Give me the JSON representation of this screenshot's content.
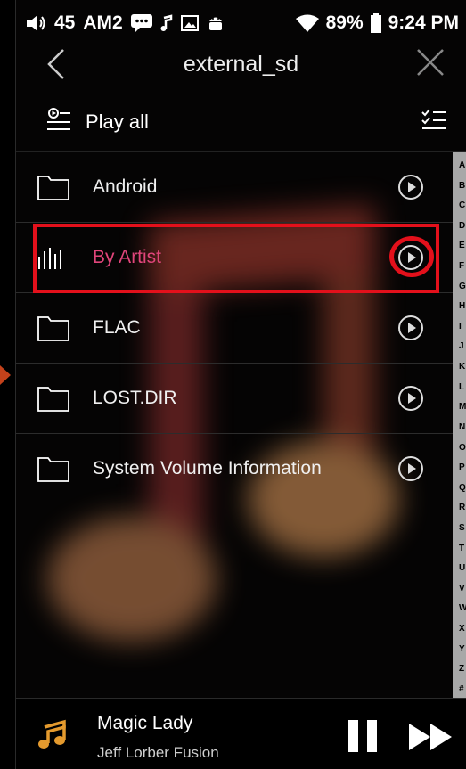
{
  "status": {
    "battery_percent": "89%",
    "time": "9:24 PM",
    "left_text": "45",
    "left_label": "AM2"
  },
  "header": {
    "title": "external_sd"
  },
  "play_all": {
    "label": "Play all"
  },
  "items": [
    {
      "label": "Android",
      "icon": "folder-icon"
    },
    {
      "label": "By Artist",
      "icon": "equalizer-icon",
      "active": true
    },
    {
      "label": "FLAC",
      "icon": "folder-icon"
    },
    {
      "label": "LOST.DIR",
      "icon": "folder-icon"
    },
    {
      "label": "System Volume Information",
      "icon": "folder-icon"
    }
  ],
  "index_letters": [
    "A",
    "B",
    "C",
    "D",
    "E",
    "F",
    "G",
    "H",
    "I",
    "J",
    "K",
    "L",
    "M",
    "N",
    "O",
    "P",
    "Q",
    "R",
    "S",
    "T",
    "U",
    "V",
    "W",
    "X",
    "Y",
    "Z",
    "#"
  ],
  "now_playing": {
    "song": "Magic Lady",
    "artist": "Jeff Lorber Fusion"
  },
  "colors": {
    "accent": "#e0457a",
    "highlight": "#e3101b",
    "note": "#e49a2e"
  }
}
